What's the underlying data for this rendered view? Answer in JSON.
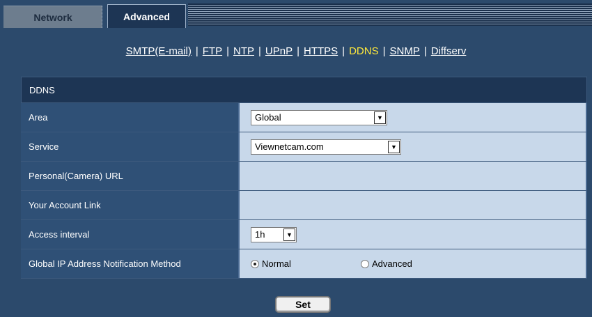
{
  "tabs": [
    {
      "label": "Network",
      "active": false
    },
    {
      "label": "Advanced",
      "active": true
    }
  ],
  "subnav": {
    "items": [
      "SMTP(E-mail)",
      "FTP",
      "NTP",
      "UPnP",
      "HTTPS",
      "DDNS",
      "SNMP",
      "Diffserv"
    ],
    "active": "DDNS",
    "separator": "|"
  },
  "section": {
    "title": "DDNS"
  },
  "rows": {
    "area": {
      "label": "Area",
      "value": "Global"
    },
    "service": {
      "label": "Service",
      "value": "Viewnetcam.com"
    },
    "personal_url": {
      "label": "Personal(Camera) URL",
      "value": ""
    },
    "account_link": {
      "label": "Your Account Link",
      "value": ""
    },
    "access_interval": {
      "label": "Access interval",
      "value": "1h"
    },
    "notification": {
      "label": "Global IP Address Notification Method",
      "options": [
        "Normal",
        "Advanced"
      ],
      "selected": "Normal"
    }
  },
  "set_button": {
    "label": "Set"
  },
  "colors": {
    "background": "#2c4a6c",
    "active_link": "#ffe93b",
    "value_bg": "#c8d8ea"
  }
}
